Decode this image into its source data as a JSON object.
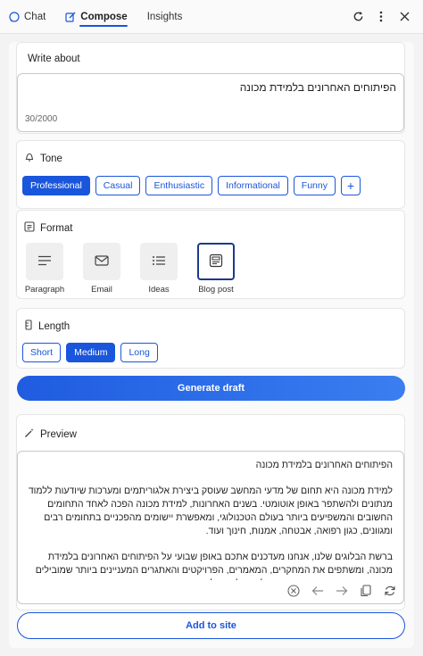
{
  "header": {
    "tabs": [
      {
        "label": "Chat",
        "icon": "chat-icon",
        "active": false
      },
      {
        "label": "Compose",
        "icon": "compose-icon",
        "active": true
      },
      {
        "label": "Insights",
        "icon": "",
        "active": false
      }
    ],
    "actions": [
      "refresh-icon",
      "more-vertical-icon"
    ]
  },
  "write_about": {
    "label": "Write about",
    "value": "הפיתוחים האחרונים בלמידת מכונה",
    "counter": "30/2000"
  },
  "tone": {
    "label": "Tone",
    "options": [
      "Professional",
      "Casual",
      "Enthusiastic",
      "Informational",
      "Funny"
    ],
    "selected": "Professional",
    "add_label": "+"
  },
  "format": {
    "label": "Format",
    "options": [
      "Paragraph",
      "Email",
      "Ideas",
      "Blog post"
    ],
    "selected": "Blog post"
  },
  "length": {
    "label": "Length",
    "options": [
      "Short",
      "Medium",
      "Long"
    ],
    "selected": "Medium"
  },
  "generate_label": "Generate draft",
  "preview": {
    "label": "Preview",
    "title": "הפיתוחים האחרונים בלמידת מכונה",
    "paragraph1": "למידת מכונה היא תחום של מדעי המחשב שעוסק ביצירת אלגוריתמים ומערכות שיודעות ללמוד מנתונים ולהשתפר באופן אוטומטי. בשנים האחרונות, למידת מכונה הפכה לאחד התחומים החשובים והמשפיעים ביותר בעולם הטכנולוגי, ומאפשרת יישומים מהפכניים בתחומים רבים ומגוונים, כגון רפואה, אבטחה, אמנות, חינוך ועוד.",
    "paragraph2": "ברשת הבלוגים שלנו, אנחנו מעדכנים אתכם באופן שבועי על הפיתוחים האחרונים בלמידת מכונה, ומשתפים את המחקרים, המאמרים, הפרויקטים והאתגרים המעניינים ביותר שמובילים את התחום. השבוע, אנחנו רוצים להציג לכם שלושה פיתוחים חדשים",
    "tools": [
      "close-circle-icon",
      "arrow-left-icon",
      "arrow-right-icon",
      "copy-icon",
      "regenerate-icon"
    ]
  },
  "add_label": "Add to site"
}
